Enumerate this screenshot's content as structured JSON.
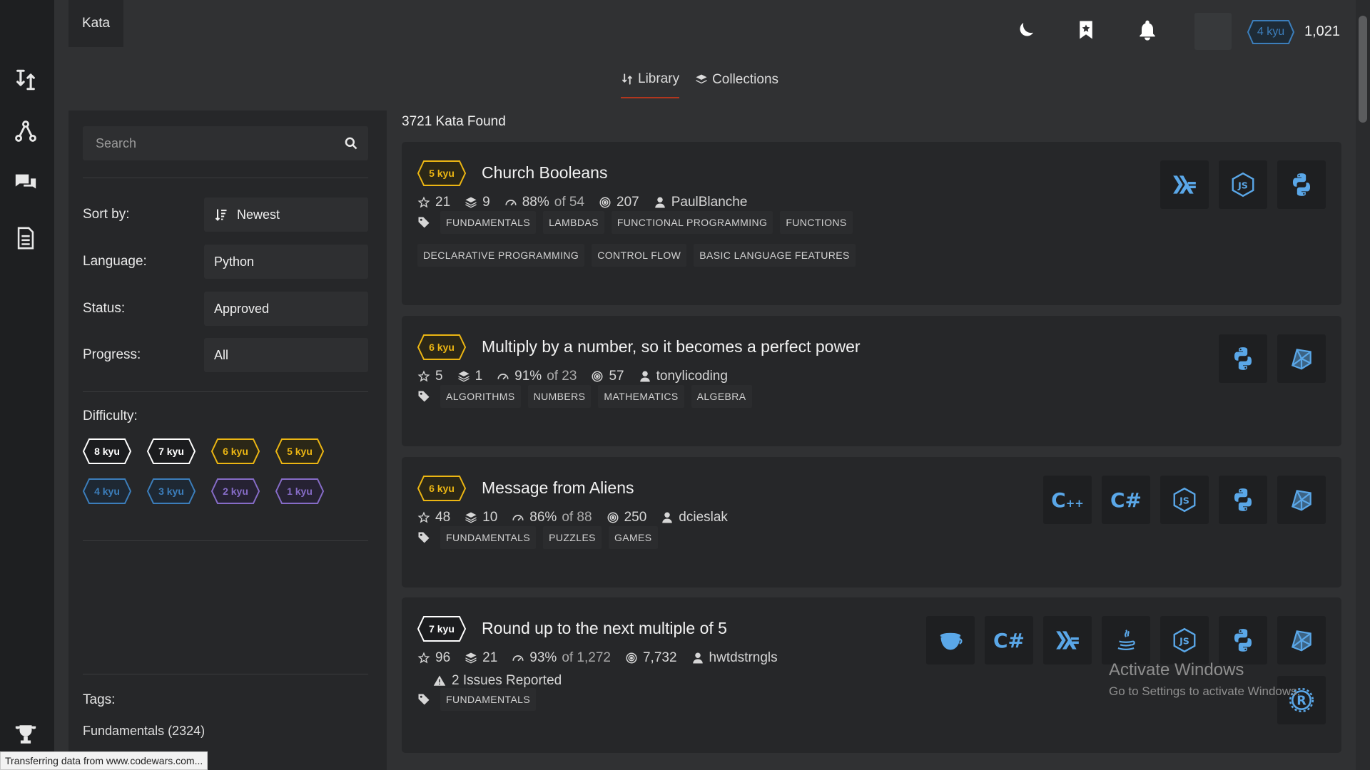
{
  "nav": {
    "kata_tab": "Kata"
  },
  "header": {
    "rank": "4 kyu",
    "honor": "1,021"
  },
  "tabs": [
    {
      "label": "Library",
      "icon": "kata-icon",
      "active": true
    },
    {
      "label": "Collections",
      "icon": "layers-icon",
      "active": false
    }
  ],
  "filters": {
    "search_placeholder": "Search",
    "sort": {
      "label": "Sort by:",
      "value": "Newest"
    },
    "language": {
      "label": "Language:",
      "value": "Python"
    },
    "status": {
      "label": "Status:",
      "value": "Approved"
    },
    "progress": {
      "label": "Progress:",
      "value": "All"
    },
    "difficulty_label": "Difficulty:",
    "difficulties": [
      {
        "label": "8 kyu",
        "color": "#ffffff"
      },
      {
        "label": "7 kyu",
        "color": "#ffffff"
      },
      {
        "label": "6 kyu",
        "color": "#ecb613"
      },
      {
        "label": "5 kyu",
        "color": "#ecb613"
      },
      {
        "label": "4 kyu",
        "color": "#3c7ebb"
      },
      {
        "label": "3 kyu",
        "color": "#3c7ebb"
      },
      {
        "label": "2 kyu",
        "color": "#866cc7"
      },
      {
        "label": "1 kyu",
        "color": "#866cc7"
      }
    ],
    "tags_label": "Tags:",
    "tags": [
      "Fundamentals (2324)"
    ]
  },
  "results": {
    "found_text": "3721 Kata Found",
    "kata": [
      {
        "rank": "5 kyu",
        "rank_color": "#ecb613",
        "title": "Church Booleans",
        "stars": "21",
        "collections": "9",
        "satisfaction": "88%",
        "votes": "of 54",
        "completions": "207",
        "author": "PaulBlanche",
        "tags": [
          [
            "FUNDAMENTALS",
            "LAMBDAS",
            "FUNCTIONAL PROGRAMMING",
            "FUNCTIONS"
          ],
          [
            "DECLARATIVE PROGRAMMING",
            "CONTROL FLOW",
            "BASIC LANGUAGE FEATURES"
          ]
        ],
        "languages": [
          "haskell-icon",
          "javascript-icon",
          "python-icon"
        ]
      },
      {
        "rank": "6 kyu",
        "rank_color": "#ecb613",
        "title": "Multiply by a number, so it becomes a perfect power",
        "stars": "5",
        "collections": "1",
        "satisfaction": "91%",
        "votes": "of 23",
        "completions": "57",
        "author": "tonylicoding",
        "tags": [
          [
            "ALGORITHMS",
            "NUMBERS",
            "MATHEMATICS",
            "ALGEBRA"
          ]
        ],
        "languages": [
          "python-icon",
          "crystal-icon"
        ]
      },
      {
        "rank": "6 kyu",
        "rank_color": "#ecb613",
        "title": "Message from Aliens",
        "stars": "48",
        "collections": "10",
        "satisfaction": "86%",
        "votes": "of 88",
        "completions": "250",
        "author": "dcieslak",
        "tags": [
          [
            "FUNDAMENTALS",
            "PUZZLES",
            "GAMES"
          ]
        ],
        "languages": [
          "cpp-icon",
          "csharp-icon",
          "javascript-icon",
          "python-icon",
          "crystal-icon"
        ]
      },
      {
        "rank": "7 kyu",
        "rank_color": "#ffffff",
        "title": "Round up to the next multiple of 5",
        "stars": "96",
        "collections": "21",
        "satisfaction": "93%",
        "votes": "of 1,272",
        "completions": "7,732",
        "author": "hwtdstrngls",
        "issues": "2 Issues Reported",
        "tags": [
          [
            "FUNDAMENTALS"
          ]
        ],
        "languages": [
          "coffeescript-icon",
          "csharp-icon",
          "haskell-icon",
          "java-icon",
          "javascript-icon",
          "python-icon",
          "crystal-icon",
          "rust-icon"
        ]
      }
    ]
  },
  "watermark": {
    "line1": "Activate Windows",
    "line2": "Go to Settings to activate Windows."
  },
  "status_bar": "Transferring data from www.codewars.com..."
}
